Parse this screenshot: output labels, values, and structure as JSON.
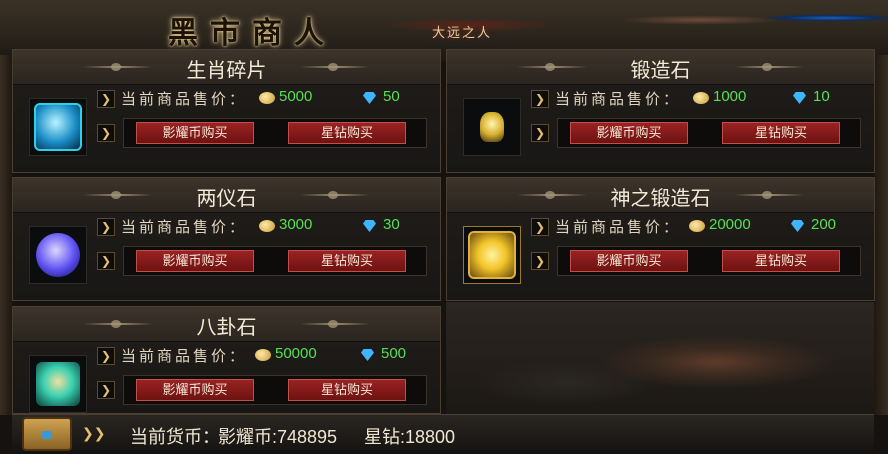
{
  "header": {
    "title": "黑市商人",
    "emblem_text": "大远之人"
  },
  "items": [
    {
      "name": "生肖碎片",
      "price_label": "当前商品售价：",
      "coin_price": "5000",
      "gem_price": "50",
      "button_coin": "影耀币购买",
      "button_gem": "星钻购买",
      "icon": "blue-crystal-icon",
      "accent": "#2fd0e6"
    },
    {
      "name": "锻造石",
      "price_label": "当前商品售价：",
      "coin_price": "1000",
      "gem_price": "10",
      "button_coin": "影耀币购买",
      "button_gem": "星钻购买",
      "icon": "forge-stone-icon",
      "accent": "#d6b030"
    },
    {
      "name": "两仪石",
      "price_label": "当前商品售价：",
      "coin_price": "3000",
      "gem_price": "30",
      "button_coin": "影耀币购买",
      "button_gem": "星钻购买",
      "icon": "purple-orb-icon",
      "accent": "#6a5cff"
    },
    {
      "name": "神之锻造石",
      "price_label": "当前商品售价：",
      "coin_price": "20000",
      "gem_price": "200",
      "button_coin": "影耀币购买",
      "button_gem": "星钻购买",
      "icon": "divine-forge-stone-icon",
      "accent": "#f2c428"
    },
    {
      "name": "八卦石",
      "price_label": "当前商品售价：",
      "coin_price": "50000",
      "gem_price": "500",
      "button_coin": "影耀币购买",
      "button_gem": "星钻购买",
      "icon": "bagua-stone-icon",
      "accent": "#3ad0b0"
    }
  ],
  "footer": {
    "label": "当前货币：",
    "coin_text": "影耀币:748895",
    "gem_text": "星钻:18800"
  },
  "colors": {
    "price_green": "#54e054",
    "button_red": "#8a1c1c",
    "gold_arrow": "#e5c070"
  }
}
